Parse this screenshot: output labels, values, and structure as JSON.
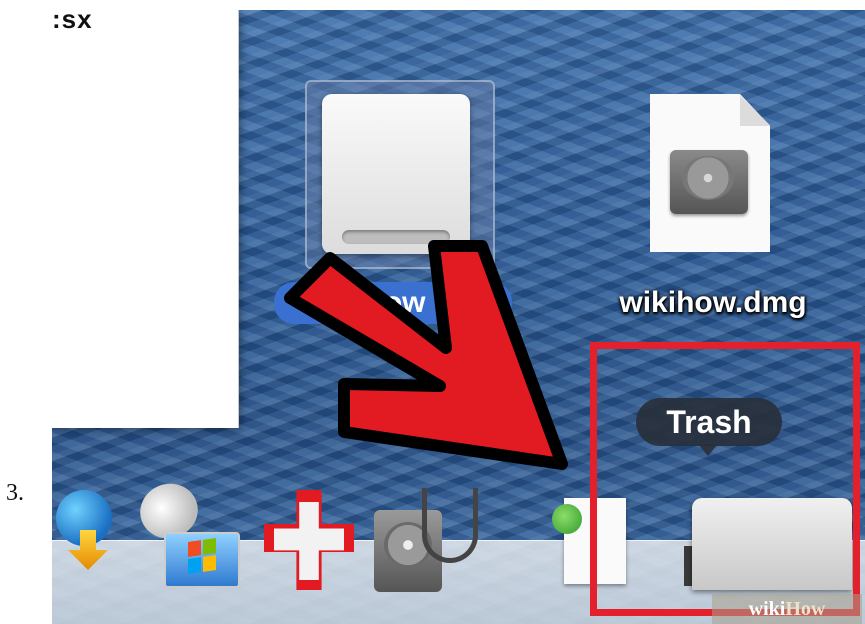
{
  "step": {
    "number": "3."
  },
  "finder": {
    "title_fragment": ":sx"
  },
  "desktop": {
    "icons": [
      {
        "label": "wikihow CD",
        "icon": "external-drive-icon",
        "selected": true
      },
      {
        "label": "wikihow.dmg",
        "icon": "disk-image-file-icon",
        "selected": false
      }
    ]
  },
  "dock": {
    "items": [
      {
        "icon": "globe-download-icon"
      },
      {
        "icon": "satellite-network-icon"
      },
      {
        "icon": "windows-vm-icon"
      },
      {
        "icon": "red-cross-icon"
      },
      {
        "icon": "disk-utility-icon"
      },
      {
        "icon": "document-icon"
      },
      {
        "icon": "trash-icon"
      }
    ],
    "tooltip": "Trash"
  },
  "annotation": {
    "arrow_color": "#e21a22",
    "highlight_color": "#e3202c"
  },
  "watermark": {
    "part1": "wiki",
    "part2": "How"
  }
}
